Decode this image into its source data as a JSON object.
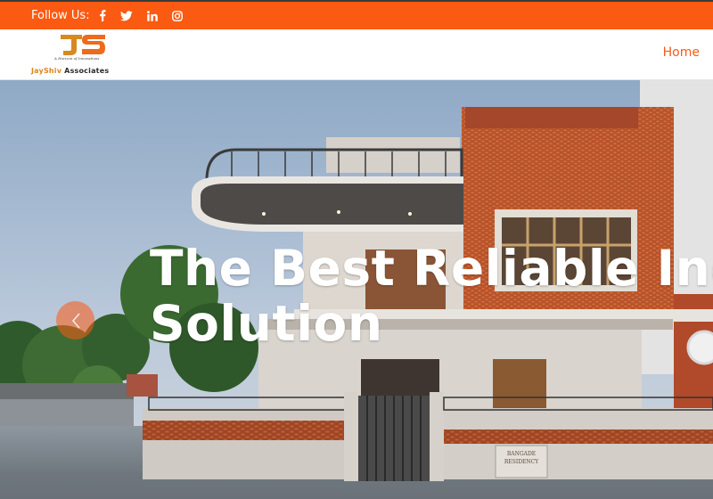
{
  "topbar": {
    "follow_label": "Follow Us:",
    "social_icons": [
      "facebook-icon",
      "twitter-icon",
      "linkedin-icon",
      "instagram-icon"
    ],
    "background_color": "#fb5a12"
  },
  "header": {
    "logo": {
      "monogram": "JS",
      "tagline": "A Horizon of Innovations",
      "brand_name": "JayShiv",
      "brand_suffix": "Associates"
    },
    "nav": {
      "home_label": "Home"
    },
    "accent_color": "#fb5a12"
  },
  "hero": {
    "title_line1": "The Best Reliable Ind",
    "title_line2": "Solution",
    "sign_text_1": "BANGADE",
    "sign_text_2": "RESIDENCY",
    "prev_icon": "chevron-left-icon"
  }
}
